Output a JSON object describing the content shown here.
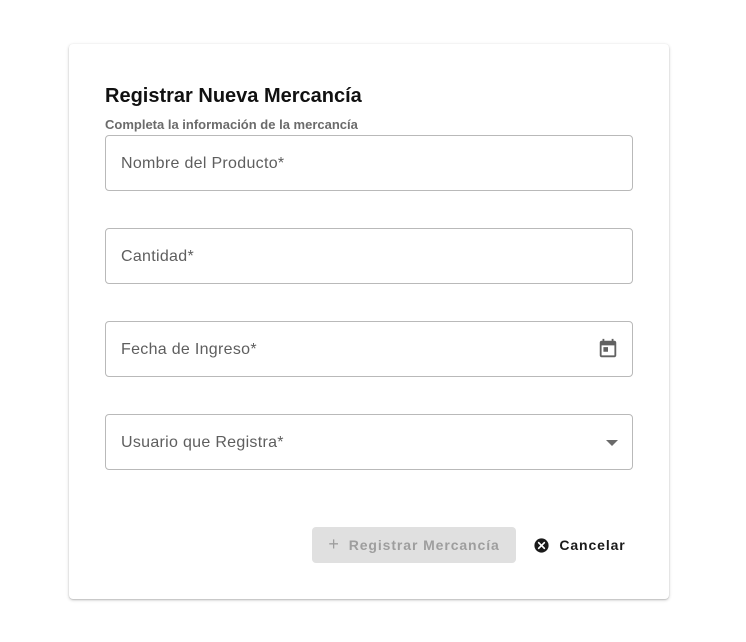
{
  "form": {
    "title": "Registrar Nueva Mercancía",
    "subtitle": "Completa la información de la mercancía",
    "fields": [
      {
        "label": "Nombre del Producto*",
        "type": "text"
      },
      {
        "label": "Cantidad*",
        "type": "number"
      },
      {
        "label": "Fecha de Ingreso*",
        "type": "date",
        "icon": "calendar-icon"
      },
      {
        "label": "Usuario que Registra*",
        "type": "select",
        "icon": "dropdown-caret-icon"
      }
    ],
    "submit_label": "Registrar Mercancía",
    "submit_icon": "plus-icon",
    "submit_disabled": true,
    "cancel_label": "Cancelar",
    "cancel_icon": "cancel-circle-icon"
  },
  "colors": {
    "border": "#b9b9b9",
    "label": "#5e5e5e",
    "disabled_bg": "#e0e0e0",
    "disabled_text": "#9e9e9e",
    "title": "#111111",
    "subtitle": "#6b6b6b"
  }
}
